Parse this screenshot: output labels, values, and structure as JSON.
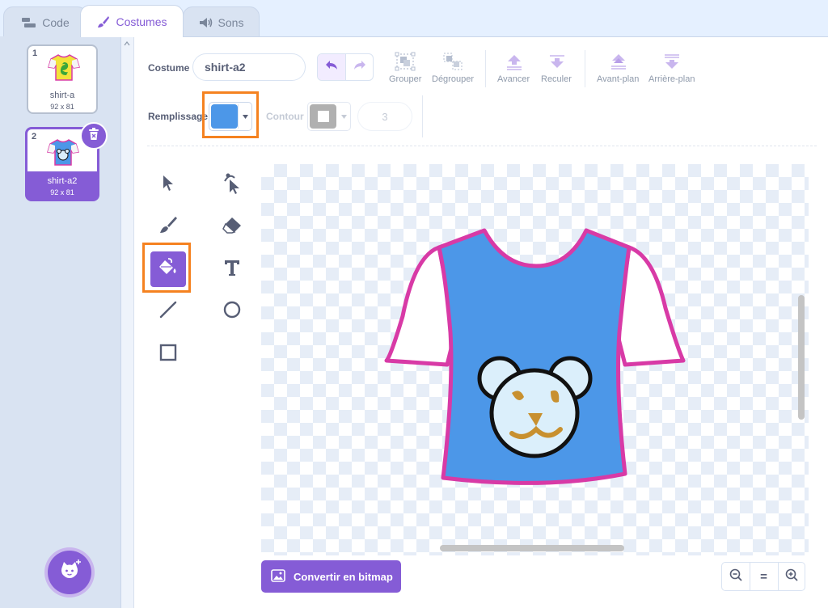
{
  "tabs": [
    {
      "label": "Code",
      "icon": "code-blocks-icon"
    },
    {
      "label": "Costumes",
      "icon": "brush-icon"
    },
    {
      "label": "Sons",
      "icon": "speaker-icon"
    }
  ],
  "costumes": [
    {
      "number": "1",
      "name": "shirt-a",
      "size": "92 x 81"
    },
    {
      "number": "2",
      "name": "shirt-a2",
      "size": "92 x 81"
    }
  ],
  "toolbar": {
    "costume_label": "Costume",
    "costume_name": "shirt-a2",
    "group": "Grouper",
    "ungroup": "Dégrouper",
    "forward": "Avancer",
    "backward": "Reculer",
    "front": "Avant-plan",
    "back": "Arrière-plan",
    "fill_label": "Remplissage",
    "outline_label": "Contour",
    "outline_width": "3"
  },
  "colors": {
    "accent": "#855cd6",
    "fill": "#4c97e8",
    "highlight": "#f58220"
  },
  "bottom": {
    "convert_label": "Convertir en bitmap",
    "zoom_reset": "="
  }
}
